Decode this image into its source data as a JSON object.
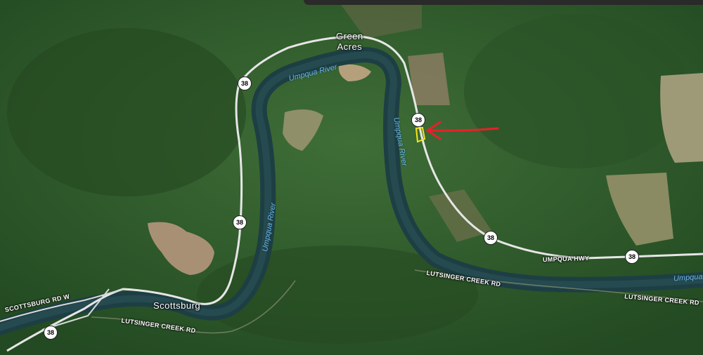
{
  "map": {
    "places": {
      "green_acres": "Green\nAcres",
      "scottsburg": "Scottsburg"
    },
    "water_labels": {
      "river_1": "Umpqua River",
      "river_2": "Umpqua River",
      "river_3": "Umpqua River",
      "river_4": "Umpqua"
    },
    "roads": {
      "umpqua_hwy": "UMPQUA HWY",
      "scottsburg_rd_w": "SCOTTSBURG RD W",
      "lutsinger_1": "LUTSINGER CREEK RD",
      "lutsinger_2": "LUTSINGER CREEK RD",
      "lutsinger_3": "LUTSINGER CREEK RD"
    },
    "route_shield": "38",
    "annotation": {
      "arrow_color": "#e8202a",
      "parcel_color": "#f5e61b"
    }
  }
}
